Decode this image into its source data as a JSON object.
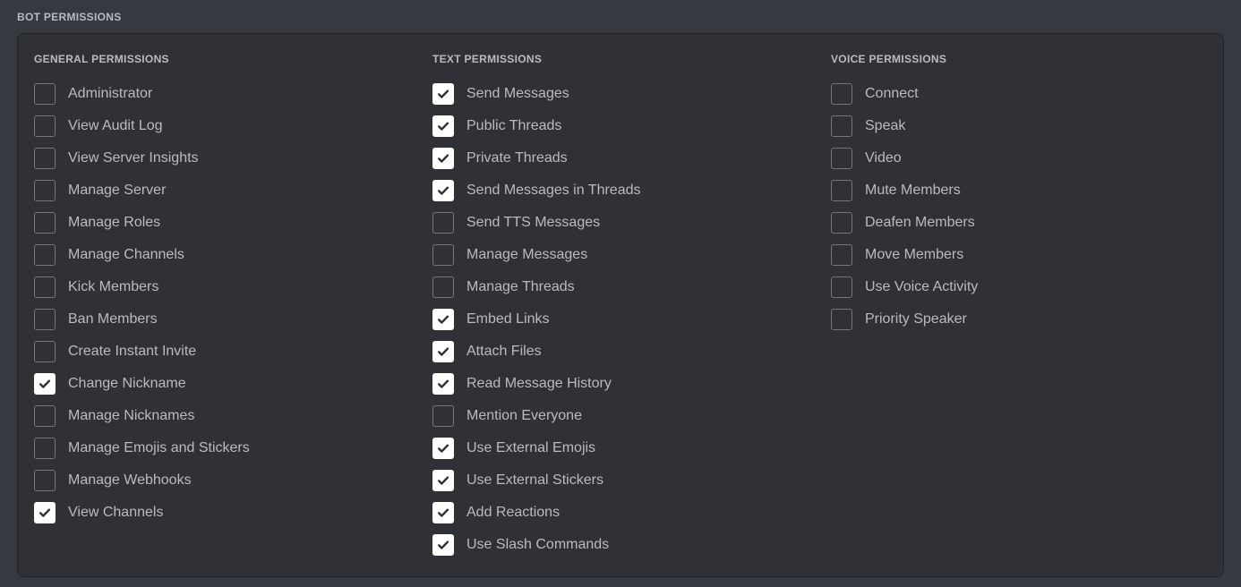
{
  "section": {
    "title": "BOT PERMISSIONS"
  },
  "colors": {
    "page_background": "#36393f",
    "panel_background": "#2f3136",
    "panel_border": "#202225",
    "label_text": "#b9bbbe",
    "checkbox_border": "#72767d",
    "checkbox_checked_fill": "#ffffff",
    "checkmark": "#2f3136"
  },
  "columns": [
    {
      "key": "general",
      "title": "GENERAL PERMISSIONS",
      "items": [
        {
          "label": "Administrator",
          "checked": false
        },
        {
          "label": "View Audit Log",
          "checked": false
        },
        {
          "label": "View Server Insights",
          "checked": false
        },
        {
          "label": "Manage Server",
          "checked": false
        },
        {
          "label": "Manage Roles",
          "checked": false
        },
        {
          "label": "Manage Channels",
          "checked": false
        },
        {
          "label": "Kick Members",
          "checked": false
        },
        {
          "label": "Ban Members",
          "checked": false
        },
        {
          "label": "Create Instant Invite",
          "checked": false
        },
        {
          "label": "Change Nickname",
          "checked": true
        },
        {
          "label": "Manage Nicknames",
          "checked": false
        },
        {
          "label": "Manage Emojis and Stickers",
          "checked": false
        },
        {
          "label": "Manage Webhooks",
          "checked": false
        },
        {
          "label": "View Channels",
          "checked": true
        }
      ]
    },
    {
      "key": "text",
      "title": "TEXT PERMISSIONS",
      "items": [
        {
          "label": "Send Messages",
          "checked": true
        },
        {
          "label": "Public Threads",
          "checked": true
        },
        {
          "label": "Private Threads",
          "checked": true
        },
        {
          "label": "Send Messages in Threads",
          "checked": true
        },
        {
          "label": "Send TTS Messages",
          "checked": false
        },
        {
          "label": "Manage Messages",
          "checked": false
        },
        {
          "label": "Manage Threads",
          "checked": false
        },
        {
          "label": "Embed Links",
          "checked": true
        },
        {
          "label": "Attach Files",
          "checked": true
        },
        {
          "label": "Read Message History",
          "checked": true
        },
        {
          "label": "Mention Everyone",
          "checked": false
        },
        {
          "label": "Use External Emojis",
          "checked": true
        },
        {
          "label": "Use External Stickers",
          "checked": true
        },
        {
          "label": "Add Reactions",
          "checked": true
        },
        {
          "label": "Use Slash Commands",
          "checked": true
        }
      ]
    },
    {
      "key": "voice",
      "title": "VOICE PERMISSIONS",
      "items": [
        {
          "label": "Connect",
          "checked": false
        },
        {
          "label": "Speak",
          "checked": false
        },
        {
          "label": "Video",
          "checked": false
        },
        {
          "label": "Mute Members",
          "checked": false
        },
        {
          "label": "Deafen Members",
          "checked": false
        },
        {
          "label": "Move Members",
          "checked": false
        },
        {
          "label": "Use Voice Activity",
          "checked": false
        },
        {
          "label": "Priority Speaker",
          "checked": false
        }
      ]
    }
  ]
}
